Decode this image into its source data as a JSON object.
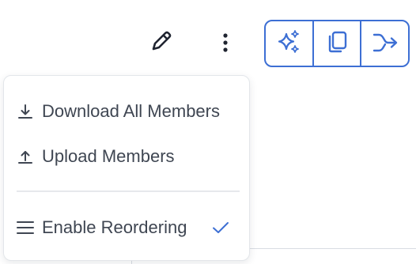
{
  "toolbar": {
    "edit_icon": "pencil-icon",
    "more_icon": "vertical-ellipsis-icon",
    "group_buttons": [
      {
        "icon": "sparkles-icon"
      },
      {
        "icon": "copy-icon"
      },
      {
        "icon": "merge-arrow-icon"
      }
    ],
    "accent_color": "#3d6fd4"
  },
  "menu": {
    "items": [
      {
        "label": "Download All Members",
        "icon": "download-icon"
      },
      {
        "label": "Upload Members",
        "icon": "upload-icon"
      },
      {
        "label": "Enable Reordering",
        "icon": "reorder-lines-icon",
        "checked": true
      }
    ],
    "text_color": "#3f4652",
    "check_color": "#3d6fd4"
  }
}
